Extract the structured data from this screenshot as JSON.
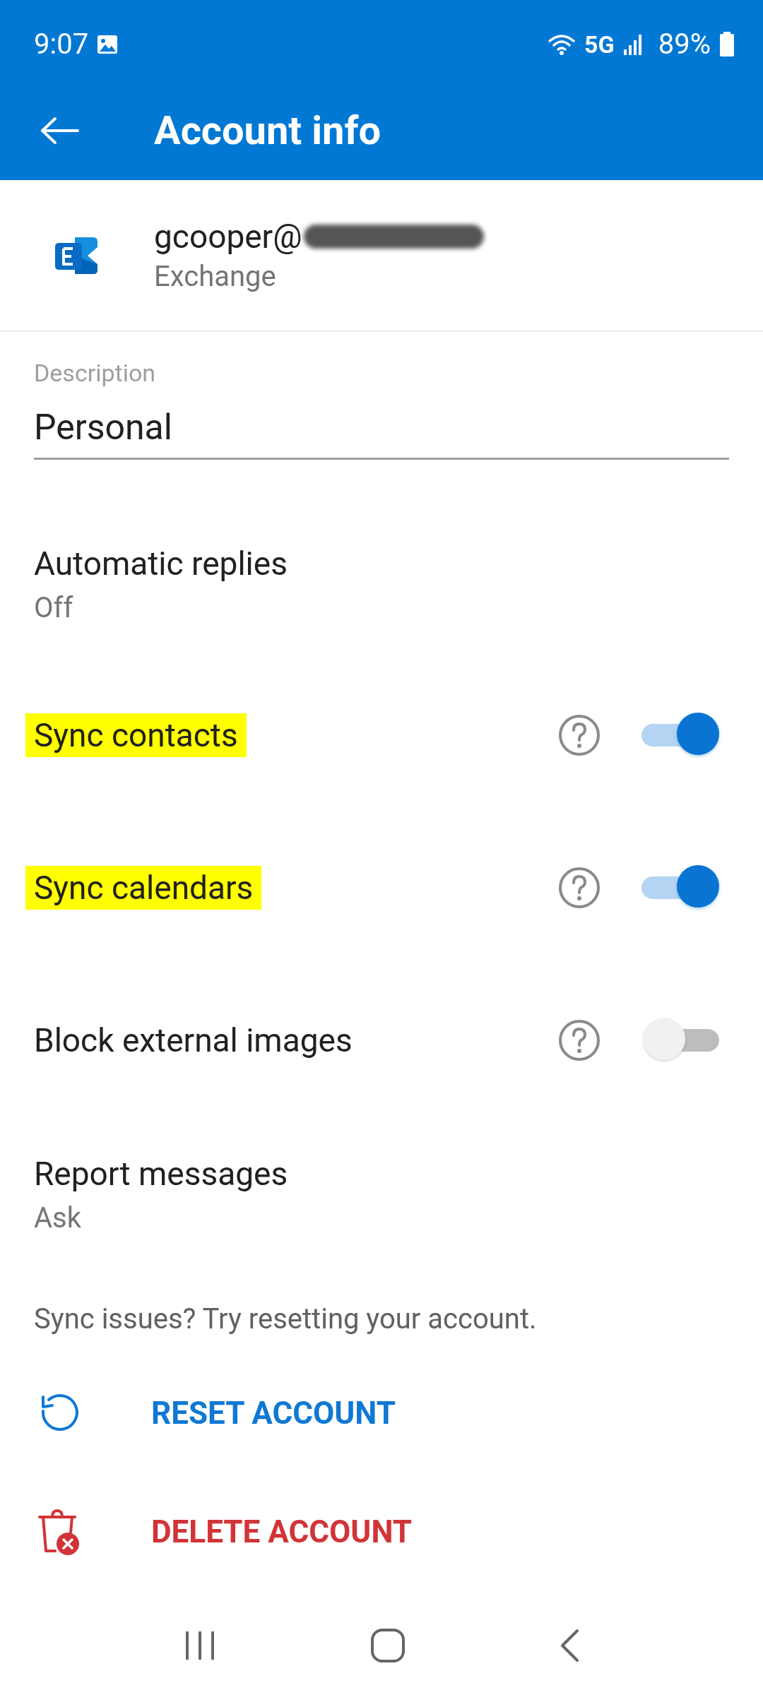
{
  "status_bar": {
    "time": "9:07",
    "network": "5G",
    "battery": "89%"
  },
  "app_bar": {
    "title": "Account info"
  },
  "account": {
    "email": "gcooper@",
    "redacted": true,
    "type": "Exchange"
  },
  "description": {
    "label": "Description",
    "value": "Personal"
  },
  "settings": [
    {
      "kind": "value",
      "label": "Automatic replies",
      "value": "Off",
      "highlighted": false
    },
    {
      "kind": "toggle",
      "label": "Sync contacts",
      "on": true,
      "highlighted": true
    },
    {
      "kind": "toggle",
      "label": "Sync calendars",
      "on": true,
      "highlighted": true
    },
    {
      "kind": "toggle",
      "label": "Block external images",
      "on": false,
      "highlighted": false
    },
    {
      "kind": "value",
      "label": "Report messages",
      "value": "Ask",
      "highlighted": false
    }
  ],
  "sync_note": "Sync issues? Try resetting your account.",
  "actions": [
    {
      "kind": "reset",
      "label": "RESET ACCOUNT"
    },
    {
      "kind": "delete",
      "label": "DELETE ACCOUNT"
    }
  ]
}
